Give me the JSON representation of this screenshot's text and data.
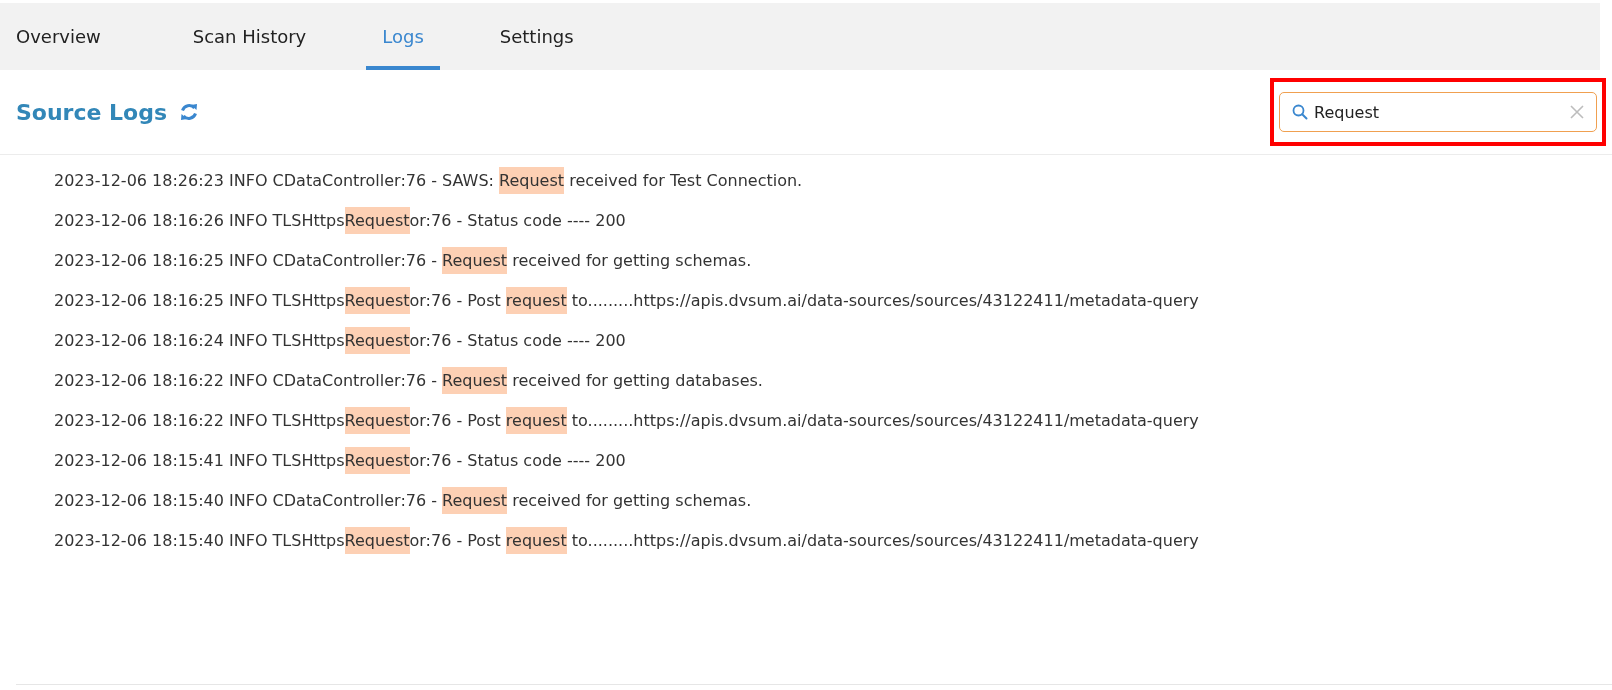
{
  "tabs": [
    {
      "label": "Overview",
      "selected": false
    },
    {
      "label": "Scan History",
      "selected": false
    },
    {
      "label": "Logs",
      "selected": true
    },
    {
      "label": "Settings",
      "selected": false
    }
  ],
  "title": "Source Logs",
  "search": {
    "value": "Request",
    "highlighted": true
  },
  "logs": [
    [
      {
        "text": "2023-12-06 18:26:23 INFO CDataController:76 - SAWS: ",
        "highlighted": false
      },
      {
        "text": "Request",
        "highlighted": true
      },
      {
        "text": " received for Test Connection.",
        "highlighted": false
      }
    ],
    [
      {
        "text": "2023-12-06 18:16:26 INFO TLSHttps",
        "highlighted": false
      },
      {
        "text": "Request",
        "highlighted": true
      },
      {
        "text": "or:76 - Status code ---- 200",
        "highlighted": false
      }
    ],
    [
      {
        "text": "2023-12-06 18:16:25 INFO CDataController:76 - ",
        "highlighted": false
      },
      {
        "text": "Request",
        "highlighted": true
      },
      {
        "text": " received for getting schemas.",
        "highlighted": false
      }
    ],
    [
      {
        "text": "2023-12-06 18:16:25 INFO TLSHttps",
        "highlighted": false
      },
      {
        "text": "Request",
        "highlighted": true
      },
      {
        "text": "or:76 - Post ",
        "highlighted": false
      },
      {
        "text": "request",
        "highlighted": true
      },
      {
        "text": " to.........https://apis.dvsum.ai/data-sources/sources/43122411/metadata-query",
        "highlighted": false
      }
    ],
    [
      {
        "text": "2023-12-06 18:16:24 INFO TLSHttps",
        "highlighted": false
      },
      {
        "text": "Request",
        "highlighted": true
      },
      {
        "text": "or:76 - Status code ---- 200",
        "highlighted": false
      }
    ],
    [
      {
        "text": "2023-12-06 18:16:22 INFO CDataController:76 - ",
        "highlighted": false
      },
      {
        "text": "Request",
        "highlighted": true
      },
      {
        "text": " received for getting databases.",
        "highlighted": false
      }
    ],
    [
      {
        "text": "2023-12-06 18:16:22 INFO TLSHttps",
        "highlighted": false
      },
      {
        "text": "Request",
        "highlighted": true
      },
      {
        "text": "or:76 - Post ",
        "highlighted": false
      },
      {
        "text": "request",
        "highlighted": true
      },
      {
        "text": " to.........https://apis.dvsum.ai/data-sources/sources/43122411/metadata-query",
        "highlighted": false
      }
    ],
    [
      {
        "text": "2023-12-06 18:15:41 INFO TLSHttps",
        "highlighted": false
      },
      {
        "text": "Request",
        "highlighted": true
      },
      {
        "text": "or:76 - Status code ---- 200",
        "highlighted": false
      }
    ],
    [
      {
        "text": "2023-12-06 18:15:40 INFO CDataController:76 - ",
        "highlighted": false
      },
      {
        "text": "Request",
        "highlighted": true
      },
      {
        "text": " received for getting schemas.",
        "highlighted": false
      }
    ],
    [
      {
        "text": "2023-12-06 18:15:40 INFO TLSHttps",
        "highlighted": false
      },
      {
        "text": "Request",
        "highlighted": true
      },
      {
        "text": "or:76 - Post ",
        "highlighted": false
      },
      {
        "text": "request",
        "highlighted": true
      },
      {
        "text": " to.........https://apis.dvsum.ai/data-sources/sources/43122411/metadata-query",
        "highlighted": false
      }
    ]
  ]
}
